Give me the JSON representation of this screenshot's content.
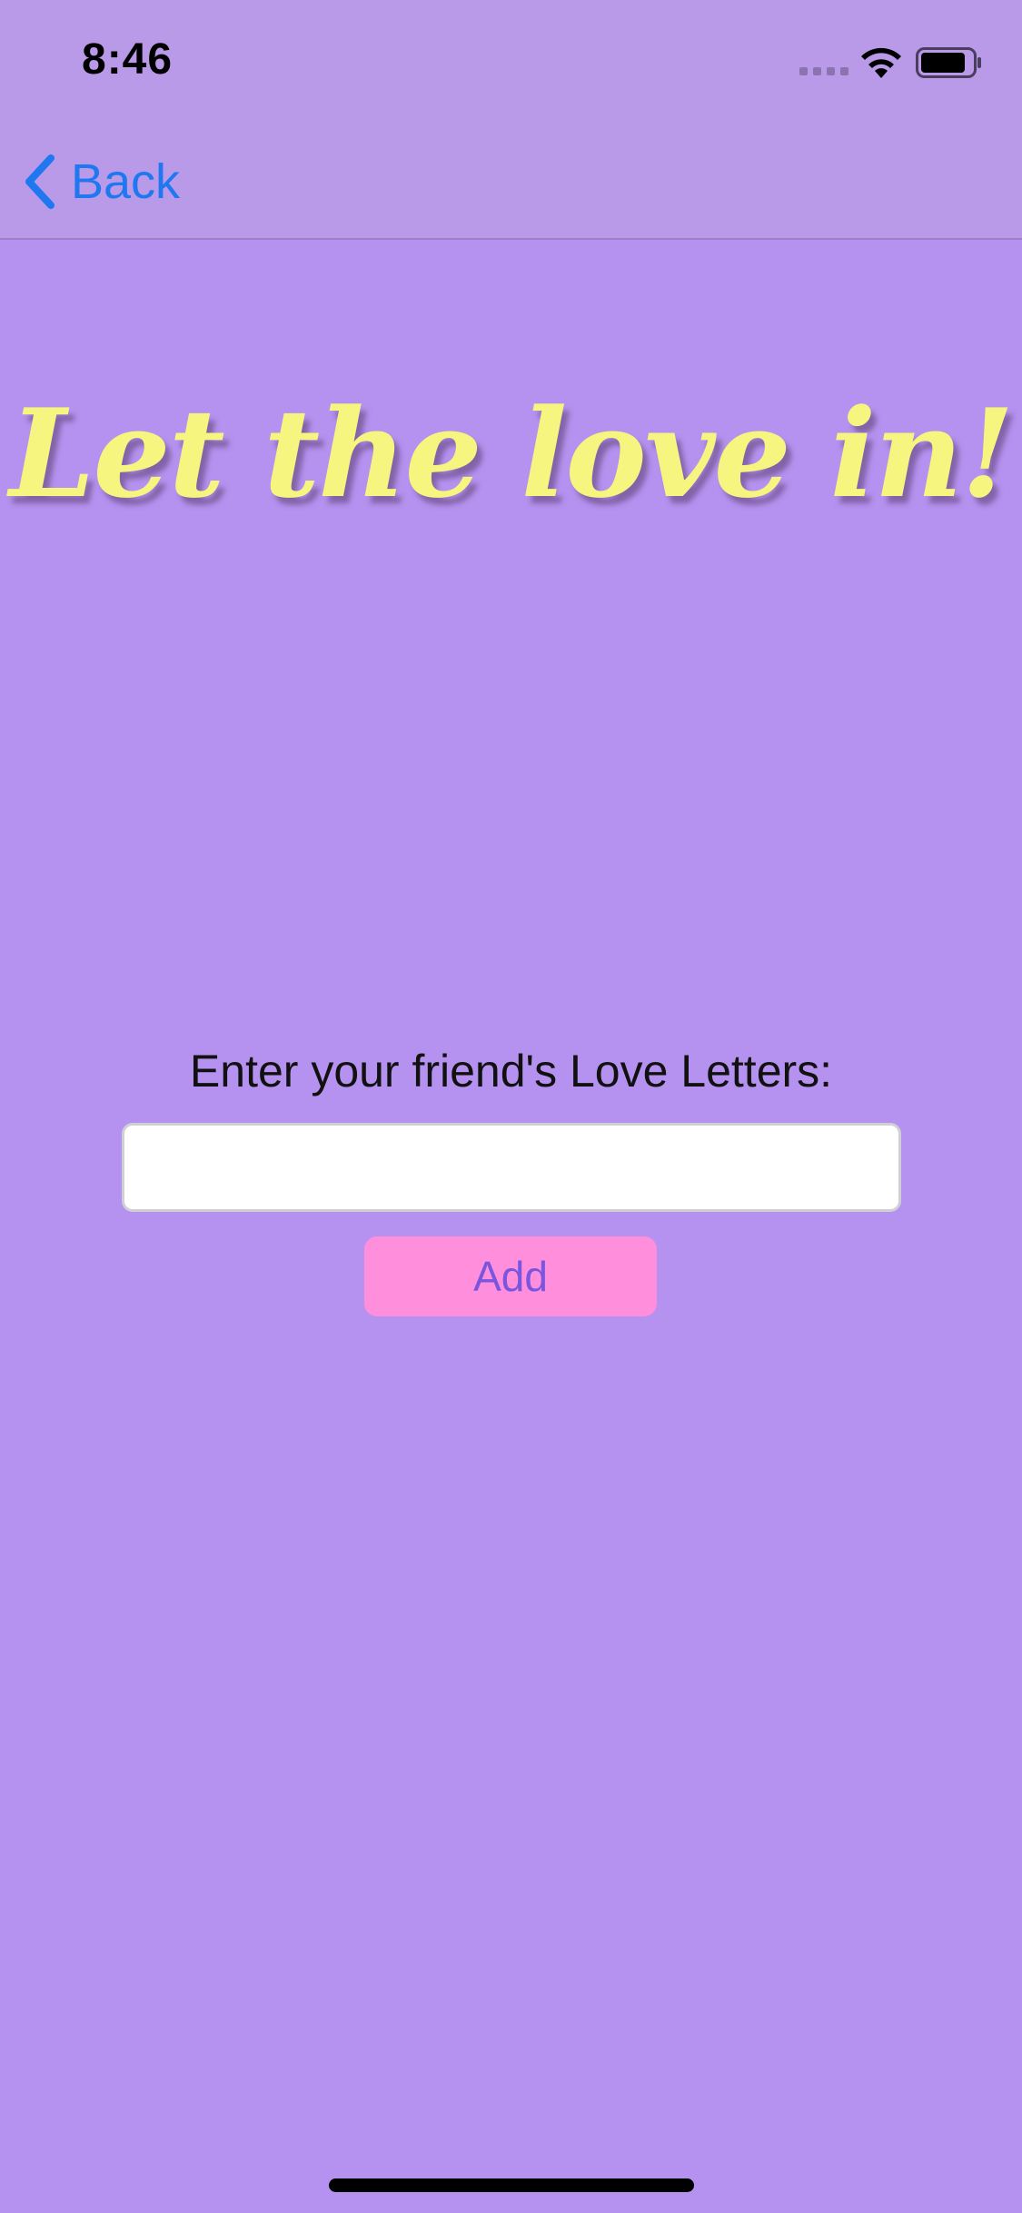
{
  "status_bar": {
    "time": "8:46"
  },
  "nav": {
    "back_label": "Back"
  },
  "headline": "Let the love in!",
  "form": {
    "prompt_label": "Enter your friend's Love Letters:",
    "input_value": "",
    "input_placeholder": "",
    "add_label": "Add"
  },
  "colors": {
    "background": "#B592EF",
    "top_bar": "#B99AE8",
    "headline": "#F6F57F",
    "link_blue": "#1F78F0",
    "add_button_bg": "#FF8EDD",
    "add_button_text": "#7A55DD"
  },
  "icons": {
    "back": "chevron-left-icon",
    "signal": "cell-signal-icon",
    "wifi": "wifi-icon",
    "battery": "battery-icon"
  }
}
